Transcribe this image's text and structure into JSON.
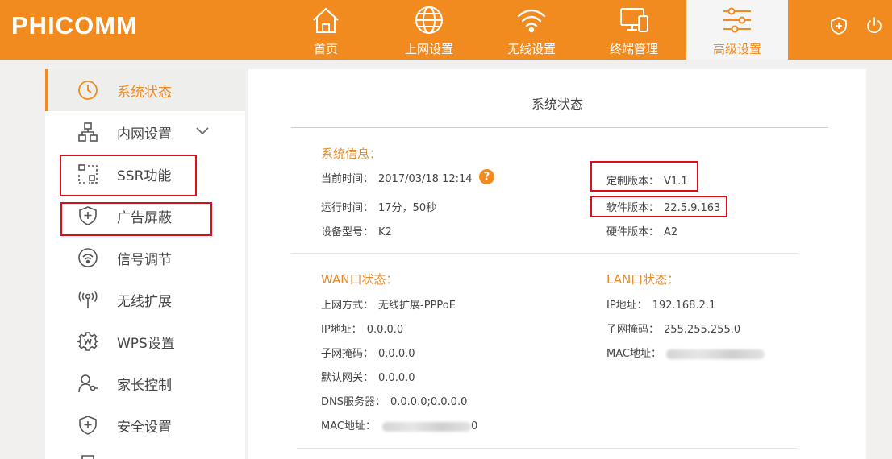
{
  "brand": {
    "logo": "PHICOMM"
  },
  "nav": [
    {
      "label": "首页",
      "icon": "home-icon"
    },
    {
      "label": "上网设置",
      "icon": "globe-icon"
    },
    {
      "label": "无线设置",
      "icon": "wifi-icon"
    },
    {
      "label": "终端管理",
      "icon": "devices-icon"
    },
    {
      "label": "高级设置",
      "icon": "sliders-icon",
      "active": true
    }
  ],
  "header_icons": [
    "shield-plus-icon",
    "power-icon"
  ],
  "sidebar": {
    "items": [
      {
        "label": "系统状态",
        "icon": "clock-icon",
        "active": true
      },
      {
        "label": "内网设置",
        "icon": "network-icon",
        "expandable": true
      },
      {
        "label": "SSR功能",
        "icon": "ssr-icon",
        "highlighted": true
      },
      {
        "label": "广告屏蔽",
        "icon": "shield-plus-icon",
        "highlighted": true
      },
      {
        "label": "信号调节",
        "icon": "signal-icon"
      },
      {
        "label": "无线扩展",
        "icon": "wireless-extend-icon"
      },
      {
        "label": "WPS设置",
        "icon": "wps-gear-icon"
      },
      {
        "label": "家长控制",
        "icon": "parental-control-icon"
      },
      {
        "label": "安全设置",
        "icon": "security-shield-icon"
      }
    ]
  },
  "main": {
    "title": "系统状态",
    "system_info": {
      "title": "系统信息：",
      "current_time_label": "当前时间：",
      "current_time": "2017/03/18 12:14",
      "help": "?",
      "uptime_label": "运行时间：",
      "uptime": "17分，50秒",
      "model_label": "设备型号：",
      "model": "K2",
      "custom_version_label": "定制版本：",
      "custom_version": "V1.1",
      "software_version_label": "软件版本：",
      "software_version": "22.5.9.163",
      "hardware_version_label": "硬件版本：",
      "hardware_version": "A2"
    },
    "wan": {
      "title": "WAN口状态：",
      "mode_label": "上网方式：",
      "mode": "无线扩展-PPPoE",
      "ip_label": "IP地址：",
      "ip": "0.0.0.0",
      "mask_label": "子网掩码：",
      "mask": "0.0.0.0",
      "gateway_label": "默认网关：",
      "gateway": "0.0.0.0",
      "dns_label": "DNS服务器：",
      "dns": "0.0.0.0;0.0.0.0",
      "mac_label": "MAC地址：",
      "mac_tail": "0"
    },
    "lan": {
      "title": "LAN口状态：",
      "ip_label": "IP地址：",
      "ip": "192.168.2.1",
      "mask_label": "子网掩码：",
      "mask": "255.255.255.0",
      "mac_label": "MAC地址："
    }
  },
  "colors": {
    "accent": "#f18a1f",
    "highlight_box": "#d9101c",
    "section_title": "#e58b2d"
  }
}
